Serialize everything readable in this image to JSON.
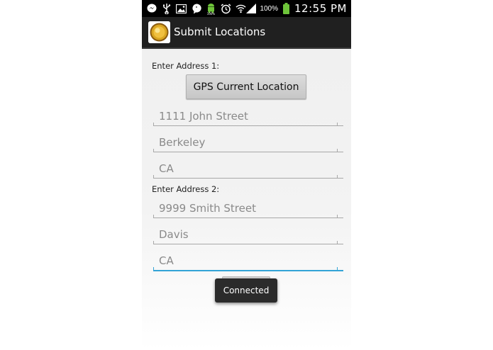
{
  "status_bar": {
    "battery_percent": "100%",
    "time": "12:55 PM",
    "icons": [
      "messenger-icon",
      "usb-icon",
      "image-icon",
      "talk-icon",
      "android-battery-icon",
      "alarm-icon",
      "wifi-icon",
      "signal-icon",
      "battery-icon"
    ]
  },
  "action_bar": {
    "title": "Submit Locations"
  },
  "address1": {
    "label": "Enter Address 1:",
    "gps_button_label": "GPS Current Location",
    "street_placeholder": "1111 John Street",
    "city_placeholder": "Berkeley",
    "state_placeholder": "CA"
  },
  "address2": {
    "label": "Enter Address 2:",
    "street_placeholder": "9999 Smith Street",
    "city_placeholder": "Davis",
    "state_placeholder": "CA"
  },
  "toast": {
    "message": "Connected"
  },
  "colors": {
    "focus_accent": "#33a3d6",
    "action_bar": "#202020",
    "battery_green": "#6ec43a",
    "logo_gold": "#d9a520"
  }
}
